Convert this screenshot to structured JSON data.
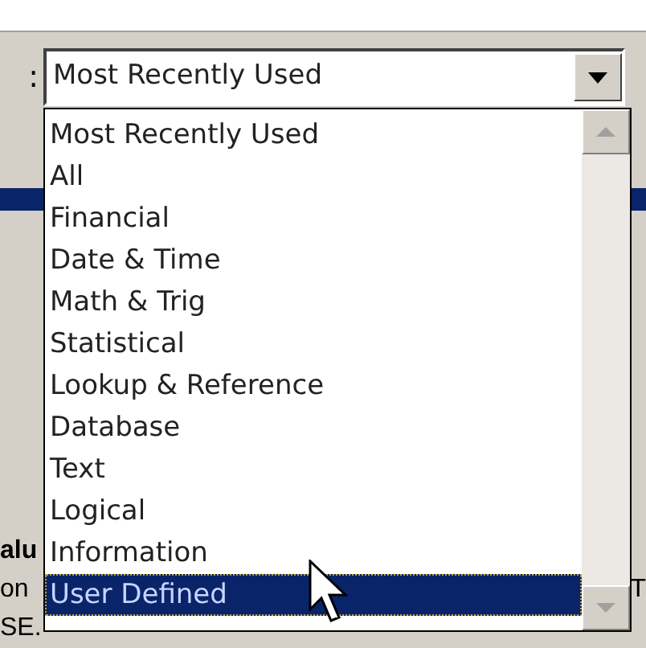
{
  "label": ":",
  "combo": {
    "value": "Most Recently Used"
  },
  "list": {
    "items": [
      {
        "label": "Most Recently Used",
        "selected": false
      },
      {
        "label": "All",
        "selected": false
      },
      {
        "label": "Financial",
        "selected": false
      },
      {
        "label": "Date & Time",
        "selected": false
      },
      {
        "label": "Math & Trig",
        "selected": false
      },
      {
        "label": "Statistical",
        "selected": false
      },
      {
        "label": "Lookup & Reference",
        "selected": false
      },
      {
        "label": "Database",
        "selected": false
      },
      {
        "label": "Text",
        "selected": false
      },
      {
        "label": "Logical",
        "selected": false
      },
      {
        "label": "Information",
        "selected": false
      },
      {
        "label": "User Defined",
        "selected": true
      }
    ]
  },
  "behind": {
    "heading": "alu",
    "line_1_left": "on",
    "line_1_right": "T",
    "line_2": "SE."
  }
}
